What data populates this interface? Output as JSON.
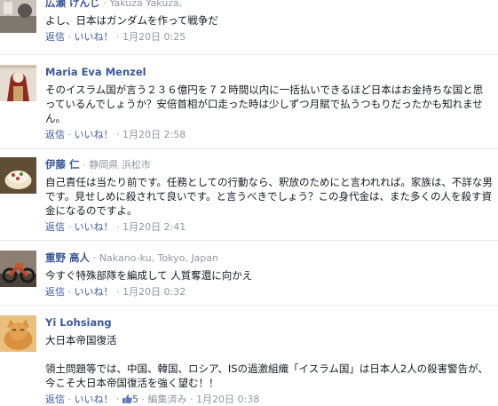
{
  "separator": "·",
  "comments": [
    {
      "author": "広瀬 けんじ",
      "location": "Yakuza Yakuza,",
      "text": [
        "よし、日本はガンダムを作って戦争だ"
      ],
      "reply": "返信",
      "like": "いいね！",
      "time": "1月20日 0:25",
      "avatar_colors": [
        "#b9b4ad",
        "#6f6a64"
      ]
    },
    {
      "author": "Maria Eva Menzel",
      "location": "",
      "text": [
        "そのイスラム国が言う２３６億円を７２時間以内に一括払いできるほど日本はお金持ちな国と思っているんでしょうか？安倍首相が口走った時は少しずつ月賦で払うつもりだったかも知れません。"
      ],
      "reply": "返信",
      "like": "いいね！",
      "time": "1月20日 2:58",
      "avatar_colors": [
        "#d9cfc4",
        "#8a2b22"
      ]
    },
    {
      "author": "伊藤 仁",
      "location": "静岡県 浜松市",
      "text": [
        "自己責任は当たり前です。任務としての行動なら、釈放のためにと言われれば。家族は、不詳な男です。見せしめに殺されて良いです。と言うべきでしょう？この身代金は、また多くの人を殺す資金になるのですよ。"
      ],
      "reply": "返信",
      "like": "いいね！",
      "time": "1月20日 2:41",
      "avatar_colors": [
        "#6b5a3e",
        "#e7d8b6"
      ]
    },
    {
      "author": "重野 高人",
      "location": "Nakano-ku, Tokyo, Japan",
      "text": [
        "今すぐ特殊部隊を編成して 人質奪還に向かえ"
      ],
      "reply": "返信",
      "like": "いいね！",
      "time": "1月20日 0:32",
      "avatar_colors": [
        "#5a4f45",
        "#b64b2a"
      ]
    },
    {
      "author": "Yi Lohsiang",
      "location": "",
      "text": [
        "大日本帝国復活",
        "領土問題等では、中国、韓国、ロシア、ISの過激組織「イスラム国」は日本人2人の殺害警告が、今こそ大日本帝国復活を強く望む！！"
      ],
      "reply": "返信",
      "like": "いいね！",
      "like_count": "5",
      "edited": "編集済み",
      "time": "1月20日 0:38",
      "avatar_colors": [
        "#d9a15a",
        "#f3d7a4"
      ]
    }
  ]
}
